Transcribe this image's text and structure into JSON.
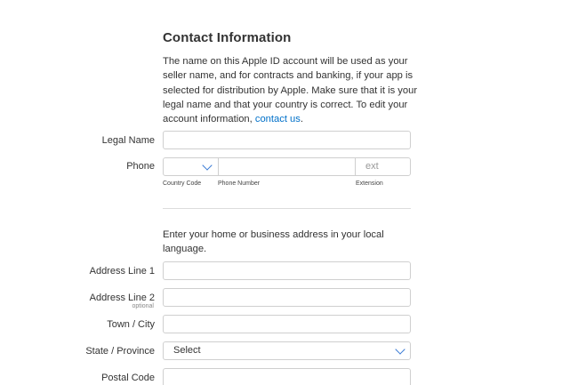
{
  "section": {
    "title": "Contact Information",
    "intro_text": "The name on this Apple ID account will be used as your seller name, and for contracts and banking, if your app is selected for distribution by Apple. Make sure that it is your legal name and that your country is correct. To edit your account information,",
    "contact_link": "contact us",
    "intro_end": "."
  },
  "fields": {
    "legal_name_label": "Legal Name",
    "phone_label": "Phone",
    "country_code_caption": "Country Code",
    "phone_number_caption": "Phone Number",
    "extension_caption": "Extension",
    "extension_placeholder": "ext"
  },
  "address": {
    "intro": "Enter your home or business address in your local language.",
    "line1_label": "Address Line 1",
    "line2_label": "Address Line 2",
    "line2_optional": "optional",
    "city_label": "Town / City",
    "state_label": "State / Province",
    "state_value": "Select",
    "postal_label": "Postal Code"
  },
  "colors": {
    "link": "#0070c9",
    "chevron": "#3a7bd5",
    "border": "#cfcfcf"
  }
}
